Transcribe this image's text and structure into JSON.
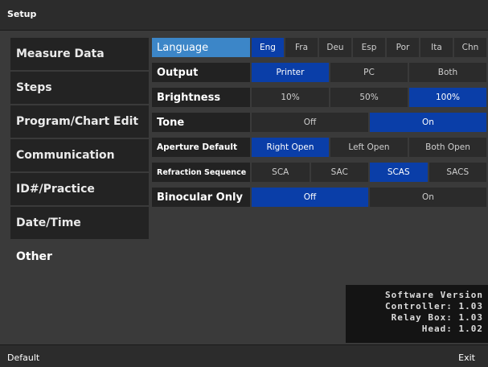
{
  "header": {
    "title": "Setup"
  },
  "sidebar": {
    "items": [
      {
        "label": "Measure Data"
      },
      {
        "label": "Steps"
      },
      {
        "label": "Program/Chart Edit"
      },
      {
        "label": "Communication"
      },
      {
        "label": "ID#/Practice"
      },
      {
        "label": "Date/Time"
      },
      {
        "label": "Other"
      }
    ],
    "active_index": 6
  },
  "settings": [
    {
      "label": "Language",
      "options": [
        "Eng",
        "Fra",
        "Deu",
        "Esp",
        "Por",
        "Ita",
        "Chn"
      ],
      "selected": "Eng"
    },
    {
      "label": "Output",
      "options": [
        "Printer",
        "PC",
        "Both"
      ],
      "selected": "Printer"
    },
    {
      "label": "Brightness",
      "options": [
        "10%",
        "50%",
        "100%"
      ],
      "selected": "100%"
    },
    {
      "label": "Tone",
      "options": [
        "Off",
        "On"
      ],
      "selected": "On"
    },
    {
      "label": "Aperture Default",
      "options": [
        "Right Open",
        "Left Open",
        "Both Open"
      ],
      "selected": "Right Open"
    },
    {
      "label": "Refraction Sequence",
      "options": [
        "SCA",
        "SAC",
        "SCAS",
        "SACS"
      ],
      "selected": "SCAS"
    },
    {
      "label": "Binocular Only",
      "options": [
        "Off",
        "On"
      ],
      "selected": "Off"
    }
  ],
  "version": {
    "title": "Software Version",
    "controller": "Controller: 1.03",
    "relay_box": "Relay Box: 1.03",
    "head": "Head: 1.02"
  },
  "footer": {
    "default_label": "Default",
    "exit_label": "Exit"
  },
  "colors": {
    "selected": "#0a3ea8",
    "highlight": "#3c86c8",
    "panel": "#3a3a3a"
  }
}
